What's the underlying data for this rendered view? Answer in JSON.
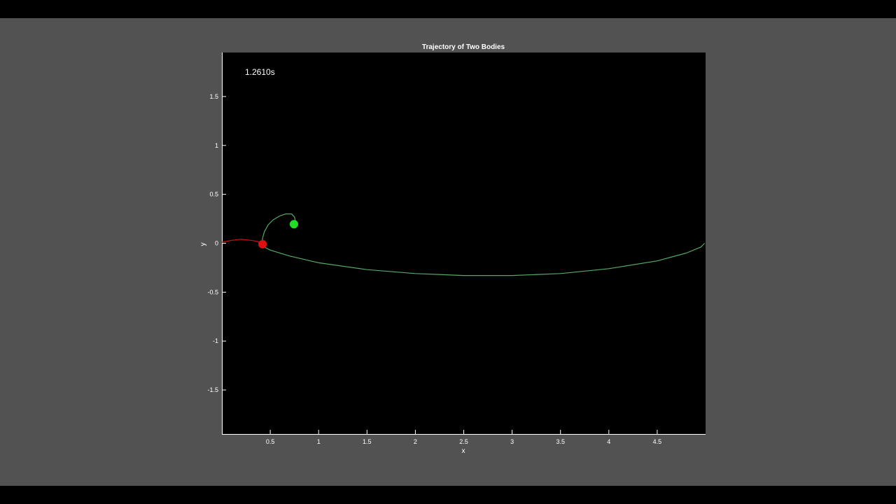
{
  "chart_data": {
    "type": "line",
    "title": "Trajectory of Two Bodies",
    "xlabel": "x",
    "ylabel": "y",
    "xlim": [
      0,
      5
    ],
    "ylim": [
      -1.95,
      1.95
    ],
    "xticks": [
      0.5,
      1,
      1.5,
      2,
      2.5,
      3,
      3.5,
      4,
      4.5
    ],
    "xtick_labels": [
      "0.5",
      "1",
      "1.5",
      "2",
      "2.5",
      "3",
      "3.5",
      "4",
      "4.5"
    ],
    "yticks": [
      -1.5,
      -1,
      -0.5,
      0,
      0.5,
      1,
      1.5
    ],
    "ytick_labels": [
      "-1.5",
      "-1",
      "-0.5",
      "0",
      "0.5",
      "1",
      "1.5"
    ],
    "grid": false,
    "time_annotation": "1.2610s",
    "series": [
      {
        "color": "#55aa66",
        "x": [
          4.99,
          4.95,
          4.8,
          4.5,
          4.0,
          3.5,
          3.0,
          2.5,
          2.0,
          1.5,
          1.0,
          0.7,
          0.5,
          0.44,
          0.42,
          0.42,
          0.44,
          0.48,
          0.53,
          0.6,
          0.66,
          0.72,
          0.75,
          0.76,
          0.75
        ],
        "y": [
          0.0,
          -0.04,
          -0.1,
          -0.18,
          -0.26,
          -0.31,
          -0.33,
          -0.33,
          -0.31,
          -0.27,
          -0.2,
          -0.13,
          -0.07,
          -0.04,
          0.0,
          0.05,
          0.12,
          0.19,
          0.24,
          0.28,
          0.3,
          0.3,
          0.27,
          0.23,
          0.2
        ]
      },
      {
        "color": "#cc1111",
        "x": [
          0.0,
          0.1,
          0.2,
          0.3,
          0.36,
          0.4,
          0.42
        ],
        "y": [
          0.01,
          0.03,
          0.04,
          0.03,
          0.02,
          0.0,
          -0.01
        ]
      }
    ],
    "bodies": [
      {
        "color": "#22dd22",
        "x": 0.745,
        "y": 0.195
      },
      {
        "color": "#dd1111",
        "x": 0.42,
        "y": -0.01
      }
    ]
  }
}
